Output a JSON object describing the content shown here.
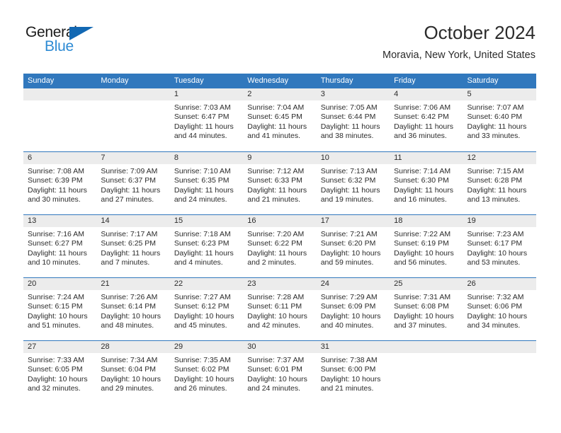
{
  "brand": {
    "word_one": "General",
    "word_two": "Blue",
    "triangle_icon": "triangle-icon",
    "accent_dark": "#1268b3",
    "accent_light": "#2e8bd4"
  },
  "header": {
    "title": "October 2024",
    "subtitle": "Moravia, New York, United States"
  },
  "calendar": {
    "header_color": "#3178bd",
    "day_band_color": "#ececec",
    "weekdays": [
      "Sunday",
      "Monday",
      "Tuesday",
      "Wednesday",
      "Thursday",
      "Friday",
      "Saturday"
    ],
    "weeks": [
      [
        {
          "day": "",
          "empty": true
        },
        {
          "day": "",
          "empty": true
        },
        {
          "day": "1",
          "sunrise": "Sunrise: 7:03 AM",
          "sunset": "Sunset: 6:47 PM",
          "daylight_1": "Daylight: 11 hours",
          "daylight_2": "and 44 minutes."
        },
        {
          "day": "2",
          "sunrise": "Sunrise: 7:04 AM",
          "sunset": "Sunset: 6:45 PM",
          "daylight_1": "Daylight: 11 hours",
          "daylight_2": "and 41 minutes."
        },
        {
          "day": "3",
          "sunrise": "Sunrise: 7:05 AM",
          "sunset": "Sunset: 6:44 PM",
          "daylight_1": "Daylight: 11 hours",
          "daylight_2": "and 38 minutes."
        },
        {
          "day": "4",
          "sunrise": "Sunrise: 7:06 AM",
          "sunset": "Sunset: 6:42 PM",
          "daylight_1": "Daylight: 11 hours",
          "daylight_2": "and 36 minutes."
        },
        {
          "day": "5",
          "sunrise": "Sunrise: 7:07 AM",
          "sunset": "Sunset: 6:40 PM",
          "daylight_1": "Daylight: 11 hours",
          "daylight_2": "and 33 minutes."
        }
      ],
      [
        {
          "day": "6",
          "sunrise": "Sunrise: 7:08 AM",
          "sunset": "Sunset: 6:39 PM",
          "daylight_1": "Daylight: 11 hours",
          "daylight_2": "and 30 minutes."
        },
        {
          "day": "7",
          "sunrise": "Sunrise: 7:09 AM",
          "sunset": "Sunset: 6:37 PM",
          "daylight_1": "Daylight: 11 hours",
          "daylight_2": "and 27 minutes."
        },
        {
          "day": "8",
          "sunrise": "Sunrise: 7:10 AM",
          "sunset": "Sunset: 6:35 PM",
          "daylight_1": "Daylight: 11 hours",
          "daylight_2": "and 24 minutes."
        },
        {
          "day": "9",
          "sunrise": "Sunrise: 7:12 AM",
          "sunset": "Sunset: 6:33 PM",
          "daylight_1": "Daylight: 11 hours",
          "daylight_2": "and 21 minutes."
        },
        {
          "day": "10",
          "sunrise": "Sunrise: 7:13 AM",
          "sunset": "Sunset: 6:32 PM",
          "daylight_1": "Daylight: 11 hours",
          "daylight_2": "and 19 minutes."
        },
        {
          "day": "11",
          "sunrise": "Sunrise: 7:14 AM",
          "sunset": "Sunset: 6:30 PM",
          "daylight_1": "Daylight: 11 hours",
          "daylight_2": "and 16 minutes."
        },
        {
          "day": "12",
          "sunrise": "Sunrise: 7:15 AM",
          "sunset": "Sunset: 6:28 PM",
          "daylight_1": "Daylight: 11 hours",
          "daylight_2": "and 13 minutes."
        }
      ],
      [
        {
          "day": "13",
          "sunrise": "Sunrise: 7:16 AM",
          "sunset": "Sunset: 6:27 PM",
          "daylight_1": "Daylight: 11 hours",
          "daylight_2": "and 10 minutes."
        },
        {
          "day": "14",
          "sunrise": "Sunrise: 7:17 AM",
          "sunset": "Sunset: 6:25 PM",
          "daylight_1": "Daylight: 11 hours",
          "daylight_2": "and 7 minutes."
        },
        {
          "day": "15",
          "sunrise": "Sunrise: 7:18 AM",
          "sunset": "Sunset: 6:23 PM",
          "daylight_1": "Daylight: 11 hours",
          "daylight_2": "and 4 minutes."
        },
        {
          "day": "16",
          "sunrise": "Sunrise: 7:20 AM",
          "sunset": "Sunset: 6:22 PM",
          "daylight_1": "Daylight: 11 hours",
          "daylight_2": "and 2 minutes."
        },
        {
          "day": "17",
          "sunrise": "Sunrise: 7:21 AM",
          "sunset": "Sunset: 6:20 PM",
          "daylight_1": "Daylight: 10 hours",
          "daylight_2": "and 59 minutes."
        },
        {
          "day": "18",
          "sunrise": "Sunrise: 7:22 AM",
          "sunset": "Sunset: 6:19 PM",
          "daylight_1": "Daylight: 10 hours",
          "daylight_2": "and 56 minutes."
        },
        {
          "day": "19",
          "sunrise": "Sunrise: 7:23 AM",
          "sunset": "Sunset: 6:17 PM",
          "daylight_1": "Daylight: 10 hours",
          "daylight_2": "and 53 minutes."
        }
      ],
      [
        {
          "day": "20",
          "sunrise": "Sunrise: 7:24 AM",
          "sunset": "Sunset: 6:15 PM",
          "daylight_1": "Daylight: 10 hours",
          "daylight_2": "and 51 minutes."
        },
        {
          "day": "21",
          "sunrise": "Sunrise: 7:26 AM",
          "sunset": "Sunset: 6:14 PM",
          "daylight_1": "Daylight: 10 hours",
          "daylight_2": "and 48 minutes."
        },
        {
          "day": "22",
          "sunrise": "Sunrise: 7:27 AM",
          "sunset": "Sunset: 6:12 PM",
          "daylight_1": "Daylight: 10 hours",
          "daylight_2": "and 45 minutes."
        },
        {
          "day": "23",
          "sunrise": "Sunrise: 7:28 AM",
          "sunset": "Sunset: 6:11 PM",
          "daylight_1": "Daylight: 10 hours",
          "daylight_2": "and 42 minutes."
        },
        {
          "day": "24",
          "sunrise": "Sunrise: 7:29 AM",
          "sunset": "Sunset: 6:09 PM",
          "daylight_1": "Daylight: 10 hours",
          "daylight_2": "and 40 minutes."
        },
        {
          "day": "25",
          "sunrise": "Sunrise: 7:31 AM",
          "sunset": "Sunset: 6:08 PM",
          "daylight_1": "Daylight: 10 hours",
          "daylight_2": "and 37 minutes."
        },
        {
          "day": "26",
          "sunrise": "Sunrise: 7:32 AM",
          "sunset": "Sunset: 6:06 PM",
          "daylight_1": "Daylight: 10 hours",
          "daylight_2": "and 34 minutes."
        }
      ],
      [
        {
          "day": "27",
          "sunrise": "Sunrise: 7:33 AM",
          "sunset": "Sunset: 6:05 PM",
          "daylight_1": "Daylight: 10 hours",
          "daylight_2": "and 32 minutes."
        },
        {
          "day": "28",
          "sunrise": "Sunrise: 7:34 AM",
          "sunset": "Sunset: 6:04 PM",
          "daylight_1": "Daylight: 10 hours",
          "daylight_2": "and 29 minutes."
        },
        {
          "day": "29",
          "sunrise": "Sunrise: 7:35 AM",
          "sunset": "Sunset: 6:02 PM",
          "daylight_1": "Daylight: 10 hours",
          "daylight_2": "and 26 minutes."
        },
        {
          "day": "30",
          "sunrise": "Sunrise: 7:37 AM",
          "sunset": "Sunset: 6:01 PM",
          "daylight_1": "Daylight: 10 hours",
          "daylight_2": "and 24 minutes."
        },
        {
          "day": "31",
          "sunrise": "Sunrise: 7:38 AM",
          "sunset": "Sunset: 6:00 PM",
          "daylight_1": "Daylight: 10 hours",
          "daylight_2": "and 21 minutes."
        },
        {
          "day": "",
          "empty": true
        },
        {
          "day": "",
          "empty": true
        }
      ]
    ]
  }
}
